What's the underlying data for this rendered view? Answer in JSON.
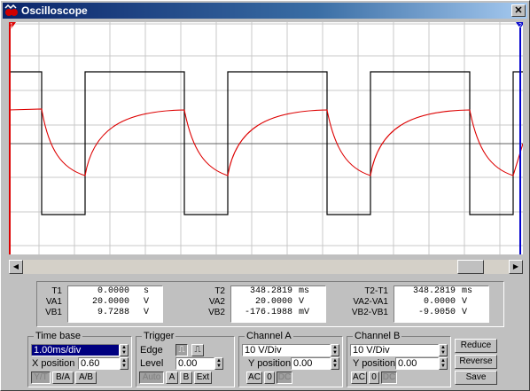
{
  "window": {
    "title": "Oscilloscope",
    "close_symbol": "✕",
    "icon": "oscilloscope-icon"
  },
  "screen": {
    "cursor_1_label": "1",
    "cursor_2_label": "2",
    "background": "#ffffff",
    "grid_color": "#c8c8c8",
    "channel_a_color": "#000000",
    "channel_b_color": "#dd0000",
    "cursor_1_color": "#dd0000",
    "cursor_2_color": "#0000cc"
  },
  "readout": {
    "t1": {
      "label": "T1",
      "value": "0.0000",
      "unit": "s"
    },
    "va1": {
      "label": "VA1",
      "value": "20.0000",
      "unit": "V"
    },
    "vb1": {
      "label": "VB1",
      "value": "9.7288",
      "unit": "V"
    },
    "t2": {
      "label": "T2",
      "value": "348.2819",
      "unit": "ms"
    },
    "va2": {
      "label": "VA2",
      "value": "20.0000",
      "unit": "V"
    },
    "vb2": {
      "label": "VB2",
      "value": "-176.1988",
      "unit": "mV"
    },
    "t2t1": {
      "label": "T2-T1",
      "value": "348.2819",
      "unit": "ms"
    },
    "va2va1": {
      "label": "VA2-VA1",
      "value": "0.0000",
      "unit": "V"
    },
    "vb2vb1": {
      "label": "VB2-VB1",
      "value": "-9.9050",
      "unit": "V"
    }
  },
  "time_base": {
    "title": "Time base",
    "scale": "1.00ms/div",
    "x_position_label": "X position",
    "x_position": "0.60",
    "modes": [
      "Y/T",
      "B/A",
      "A/B"
    ]
  },
  "trigger": {
    "title": "Trigger",
    "edge_label": "Edge",
    "level_label": "Level",
    "level": "0.00",
    "sources": [
      "Auto",
      "A",
      "B",
      "Ext"
    ]
  },
  "channel_a": {
    "title": "Channel A",
    "scale": "10 V/Div",
    "y_position_label": "Y position",
    "y_position": "0.00",
    "coupling": [
      "AC",
      "0",
      "DC"
    ]
  },
  "channel_b": {
    "title": "Channel B",
    "scale": "10 V/Div",
    "y_position_label": "Y position",
    "y_position": "0.00",
    "coupling": [
      "AC",
      "0",
      "DC"
    ]
  },
  "actions": {
    "reduce": "Reduce",
    "reverse": "Reverse",
    "save": "Save"
  },
  "scrollbar": {
    "left_arrow": "◀",
    "right_arrow": "▶",
    "position": 0.92
  }
}
